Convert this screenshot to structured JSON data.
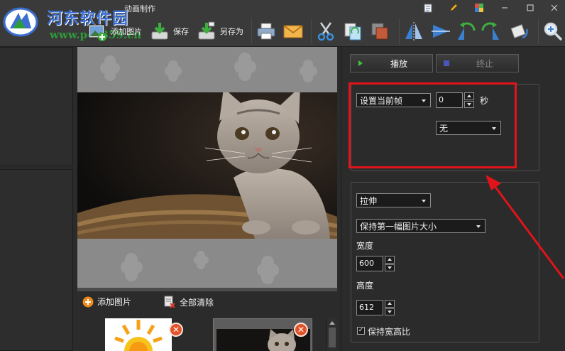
{
  "window": {
    "title": "动画制作",
    "controls": [
      "file-icon",
      "pencil-icon",
      "palette-icon",
      "minimize",
      "maximize",
      "close"
    ]
  },
  "watermark": {
    "site_name": "河东软件园",
    "url": "www.pc0359.cn"
  },
  "toolbar": {
    "add_image_label": "添加图片",
    "save_label": "保存",
    "save_as_label": "另存为",
    "icons": [
      "add-image-icon",
      "save-icon",
      "save-as-icon",
      "print-icon",
      "mail-icon",
      "cut-icon",
      "copy-icon",
      "crop-icon",
      "flip-horizontal-icon",
      "flip-vertical-icon",
      "rotate-left-icon",
      "rotate-right-icon",
      "rotate-icon",
      "zoom-in-icon"
    ]
  },
  "preview": {
    "image": "kitten-photo"
  },
  "thumbs": {
    "add_image_label": "添加图片",
    "clear_all_label": "全部清除",
    "items": [
      {
        "name": "sun-clipart"
      },
      {
        "name": "kitten-photo"
      }
    ]
  },
  "playback": {
    "play_label": "播放",
    "stop_label": "终止"
  },
  "frame_settings": {
    "frame_select_value": "设置当前帧",
    "seconds_value": "0",
    "seconds_unit": "秒",
    "transition_value": "无"
  },
  "size_settings": {
    "resize_mode_value": "拉伸",
    "size_source_value": "保持第一幅图片大小",
    "width_label": "宽度",
    "width_value": "600",
    "height_label": "高度",
    "height_value": "612",
    "keep_ratio_label": "保持宽高比",
    "keep_ratio_checked": true
  },
  "colors": {
    "background": "#2b2b2b",
    "toolbar": "#3a3a3a",
    "highlight": "#e0141a",
    "logo_blue": "#3b6fd0",
    "logo_green": "#2f9c3a",
    "close_badge": "#e25329"
  }
}
